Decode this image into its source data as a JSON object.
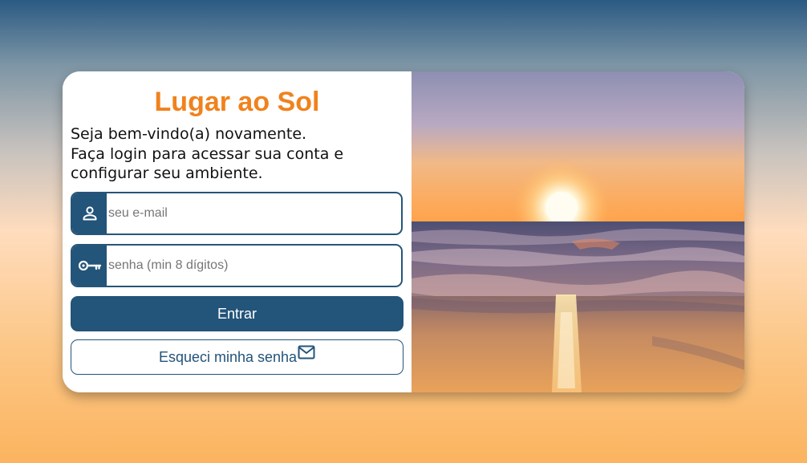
{
  "app": {
    "title": "Lugar ao Sol",
    "welcome_lines": [
      "Seja bem-vindo(a) novamente.",
      "Faça login para acessar sua conta e",
      "configurar seu ambiente."
    ]
  },
  "form": {
    "email": {
      "placeholder": "seu e-mail",
      "value": "",
      "icon": "person-icon"
    },
    "password": {
      "placeholder": "senha (min 8 dígitos)",
      "value": "",
      "icon": "key-icon"
    },
    "submit_label": "Entrar",
    "forgot_label": "Esqueci minha senha",
    "forgot_icon": "mail-icon"
  },
  "colors": {
    "brand_orange": "#f0821d",
    "primary_blue": "#235479"
  },
  "image": {
    "description_icon": "sunset-beach-photo"
  }
}
